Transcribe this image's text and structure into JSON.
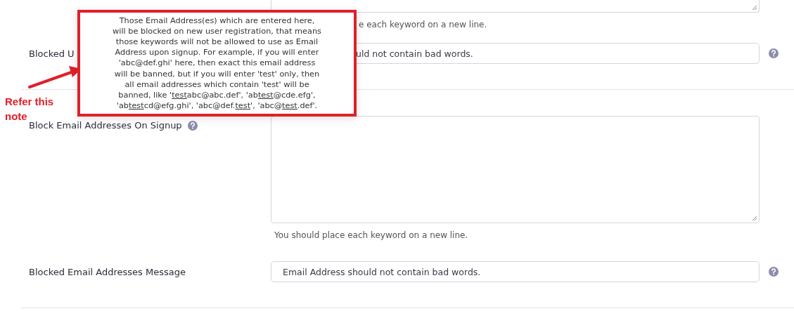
{
  "top_section": {
    "hint": "e each keyword on a new line.",
    "label": "Blocked U",
    "input_value": "uld not contain bad words.",
    "help": true
  },
  "sections": [
    {
      "kind": "textarea",
      "label": "Block Email Addresses On Signup",
      "help": true,
      "hint": "You should place each keyword on a new line."
    },
    {
      "kind": "input",
      "label": "Blocked Email Addresses Message",
      "help": true,
      "value": "Email Address should not contain bad words."
    }
  ],
  "tooltip": {
    "lines": [
      [
        {
          "text": "Those Email Address(es) which are entered here,",
          "underlined": false
        }
      ],
      [
        {
          "text": "will be blocked on new user registration, that means",
          "underlined": false
        }
      ],
      [
        {
          "text": "those keywords will not be allowed to use as Email",
          "underlined": false
        }
      ],
      [
        {
          "text": "Address upon signup. For example, if you will enter",
          "underlined": false
        }
      ],
      [
        {
          "text": "'abc@def.ghi' here, then exact this email address",
          "underlined": false
        }
      ],
      [
        {
          "text": "will be banned, but if you will enter 'test' only, then",
          "underlined": false
        }
      ],
      [
        {
          "text": "all email addresses which contain 'test' will be",
          "underlined": false
        }
      ],
      [
        {
          "text": "banned, like '",
          "underlined": false
        },
        {
          "text": "test",
          "underlined": true
        },
        {
          "text": "abc@abc.def', 'ab",
          "underlined": false
        },
        {
          "text": "test",
          "underlined": true
        },
        {
          "text": "@cde.efg',",
          "underlined": false
        }
      ],
      [
        {
          "text": "'ab",
          "underlined": false
        },
        {
          "text": "test",
          "underlined": true
        },
        {
          "text": "cd@efg.ghi', 'abc@def.",
          "underlined": false
        },
        {
          "text": "test",
          "underlined": true
        },
        {
          "text": "', 'abc@",
          "underlined": false
        },
        {
          "text": "test",
          "underlined": true
        },
        {
          "text": ".def'.",
          "underlined": false
        }
      ]
    ]
  },
  "annotation": {
    "note": "Refer this note"
  }
}
